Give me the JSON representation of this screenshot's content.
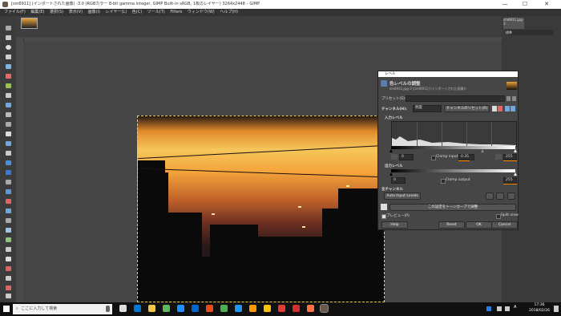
{
  "window": {
    "title": "[sm6911] (インポートされた画像) -3.0 (RGBカラー 8-bit gamma integer, GIMP Built-in sRGB, 1枚のレイヤー) 3264x2448 – GIMP",
    "min": "—",
    "max": "☐",
    "close": "✕"
  },
  "menubar": [
    "ファイル(F)",
    "編集(E)",
    "選択(S)",
    "表示(V)",
    "画像(I)",
    "レイヤー(L)",
    "色(C)",
    "ツール(T)",
    "Filters",
    "ウィンドウ(W)",
    "ヘルプ(H)"
  ],
  "dock": {
    "tab_label": "sm6911.jpg-3",
    "mode": "標準"
  },
  "dialog": {
    "titlebar": "レベル",
    "header": "色レベルの調整",
    "subheader": "sm6911.jpg-3 ([sm6911] (インポートされた画像))",
    "presets_label": "プリセット(S):",
    "channel_label": "チャンネル(H):",
    "channel_value": "明度",
    "channel_reset": "チャンネルのリセット(R)",
    "input_levels": "入力レベル",
    "clamp_input": "Clamp input",
    "input_low": "0",
    "input_gamma": "0.35",
    "input_high": "255",
    "output_levels": "出力レベル",
    "clamp_output": "Clamp output",
    "output_low": "0",
    "output_high": "255",
    "all_channels": "全チャンネル",
    "auto_input": "Auto Input Levels",
    "edit_curves": "この設定をトーンカーブで調整",
    "preview": "プレビュー(P)",
    "split_view": "Split view",
    "help": "Help",
    "reset": "Reset",
    "ok": "OK",
    "cancel": "Cancel"
  },
  "taskbar": {
    "search_placeholder": "ここに入力して検索",
    "time": "17:36",
    "date": "2018/02/26",
    "ime": "A"
  },
  "colors": {
    "accent": "#ff8c00",
    "dialog_bg": "#464646",
    "taskbar": "#101010"
  }
}
